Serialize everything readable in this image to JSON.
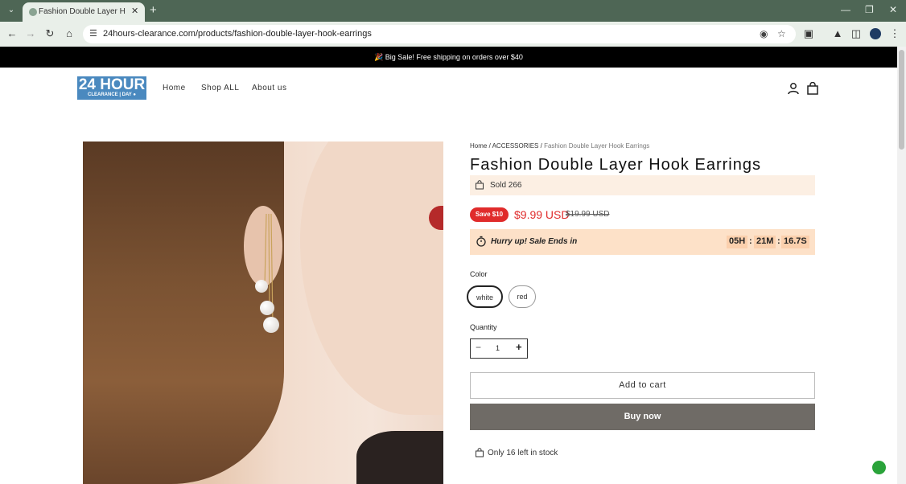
{
  "browser": {
    "tab_title": "Fashion Double Layer Hook Ea",
    "url": "24hours-clearance.com/products/fashion-double-layer-hook-earrings",
    "icons": [
      "tab-list-icon",
      "close-icon",
      "new-tab-icon",
      "minimize-icon",
      "restore-icon",
      "window-close-icon",
      "back-icon",
      "forward-icon",
      "reload-icon",
      "home-icon",
      "site-info-icon",
      "eye-off-icon",
      "star-icon",
      "extensions-icon",
      "labs-icon",
      "side-panel-icon",
      "profile-icon",
      "more-icon"
    ]
  },
  "announcement": "🎉 Big Sale!  Free shipping on orders over $40",
  "logo": {
    "line1": "24 HOUR",
    "line2": "CLEARANCE | DAY ●",
    "color": "#4a89bf"
  },
  "nav": {
    "items": [
      "Home",
      "Shop ALL",
      "About us"
    ]
  },
  "breadcrumb": {
    "home": "Home",
    "sep1": "/",
    "category": "ACCESSORIES",
    "sep2": "/",
    "current": "Fashion Double Layer Hook Earrings"
  },
  "product": {
    "title": "Fashion Double Layer Hook Earrings",
    "sold": "Sold 266",
    "save_badge": "Save $10",
    "price": "$9.99 USD",
    "compare_price": "$19.99 USD",
    "price_color": "#e02b2b"
  },
  "timer": {
    "text": "Hurry up! Sale Ends in",
    "hours": "05H",
    "minutes": "21M",
    "seconds": "16.7S",
    "sep": ":"
  },
  "color_option": {
    "label": "Color",
    "options": [
      "white",
      "red"
    ],
    "selected": "white"
  },
  "quantity": {
    "label": "Quantity",
    "value": "1",
    "minus": "−",
    "plus": "+"
  },
  "buttons": {
    "add_to_cart": "Add to cart",
    "buy_now": "Buy now"
  },
  "stock": "Only 16 left in stock"
}
